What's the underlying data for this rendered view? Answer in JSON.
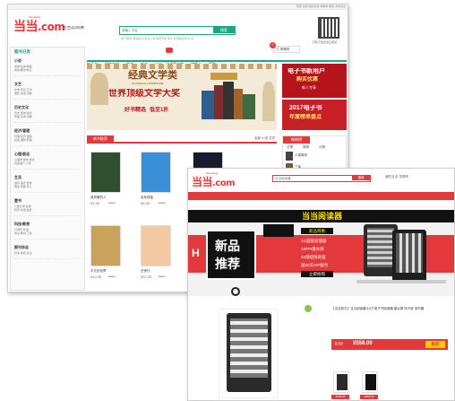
{
  "window1": {
    "logo": "当当",
    "logo_tail": ".com",
    "logo_sub": "dangdang",
    "channel": "当当云阅读",
    "top_links": "登录 注册 我的当当 购物车 帮助 手机当当",
    "search_placeholder": "请输入书名",
    "search_button": "搜索",
    "hot_words": "热门搜索: 畅销好书 新书上架 免费专区 电子书 网络文学 听书",
    "qr_caption": "扫码下载当当云阅读",
    "cart_label": "购物车",
    "cart_count": "0",
    "nav": [
      "电子书",
      "网络文学",
      "原创",
      "听书",
      "当当云阅读客户端",
      "储值卡",
      "签到"
    ],
    "sidebar": {
      "title": "图书分类",
      "groups": [
        {
          "title": "小说",
          "lines": [
            "武侠/仙侠/悬疑",
            "言情/都市/科幻"
          ]
        },
        {
          "title": "文艺",
          "lines": [
            "文学 传记 艺术",
            "摄影 动漫 诗歌"
          ]
        },
        {
          "title": "历史文化",
          "lines": [
            "历史 国学 政治",
            "军事 哲学 宗教"
          ]
        },
        {
          "title": "经济/管理",
          "lines": [
            "管理 经济 金融",
            "投资 理财 营销"
          ]
        },
        {
          "title": "心理/励志",
          "lines": [
            "心理学 励志 成功",
            "自我提升 人际"
          ]
        },
        {
          "title": "生活",
          "lines": [
            "健身 美食 旅游",
            "两性 家居 育儿"
          ]
        },
        {
          "title": "童书",
          "lines": [
            "儿童文学 绘本",
            "科普 动漫 益智"
          ]
        },
        {
          "title": "科技/教育",
          "lines": [
            "计算机 外语",
            "考试 教材 工具"
          ]
        },
        {
          "title": "期刊杂志",
          "lines": [
            "时尚 新闻 生活"
          ]
        }
      ]
    },
    "banner": {
      "headline": "经典文学类",
      "en": "CLASSICAL LITERATURE",
      "subline": "世界顶级文学大奖",
      "promo": "好书精选",
      "promo2": "低至1折"
    },
    "side_ad1": {
      "line1": "电子书新用户",
      "line2": "购买优惠",
      "sub": "新人专享"
    },
    "side_ad2": {
      "line1": "2017电子书",
      "line2": "年度榜单盘点"
    },
    "section_title": "新书推荐",
    "section_tabs": [
      "全部",
      "小说",
      "文学"
    ],
    "rank_title": "畅销榜",
    "rank_tabs": [
      "日榜",
      "周榜",
      "月榜"
    ],
    "rank_items": [
      "人类简史",
      "三体"
    ],
    "books": [
      {
        "title": "追风筝的人",
        "price": "¥4.99",
        "old": "¥19.8"
      },
      {
        "title": "百年孤独",
        "price": "¥3.99",
        "old": "¥15.0"
      },
      {
        "title": "活着",
        "price": "¥4.00",
        "old": "¥12.0"
      },
      {
        "title": "平凡的世界",
        "price": "¥12.99",
        "old": "¥30.0"
      },
      {
        "title": "白夜行",
        "price": "¥12.00",
        "old": "¥29.0"
      },
      {
        "title": "解忧杂货店",
        "price": "¥19.99",
        "old": "¥39.0"
      }
    ]
  },
  "window2": {
    "logo": "当当",
    "logo_tail": ".com",
    "logo_sub": "dangdang",
    "search_placeholder": "当当阅读器",
    "search_button": "搜索",
    "top_links": [
      "我的当当",
      "购物车"
    ],
    "nav": [
      "全部商品分类",
      "首页",
      "图书",
      "电子书",
      "网络文学",
      "服装",
      "运动户外",
      "孕婴童",
      "家居",
      "家纺",
      "箱包",
      "Apple",
      "电脑"
    ],
    "subnav": [
      "图书分类",
      "童书",
      "小说",
      "文学",
      "艺术",
      "经管",
      "励志",
      "科技",
      "教辅",
      "考试",
      "生活"
    ],
    "hero_title": "当当阅读器",
    "hero_new1": "新品",
    "hero_new2": "推荐",
    "hero_tag": "新品特惠",
    "hero_specs": [
      "1G超极处理器",
      "16PPI墨水屏",
      "32倍超快处理",
      "送30天VIP服务"
    ],
    "hero_btn": "立即抢购",
    "product_desc": "【当当官方】当当阅读器 8 6寸电子书阅读器 墨水屏 电子纸 读书器",
    "price_label": "当当价",
    "price": "¥558.00",
    "buy": "购买",
    "thumb_prices": [
      "¥558.00",
      "¥699.00"
    ]
  }
}
